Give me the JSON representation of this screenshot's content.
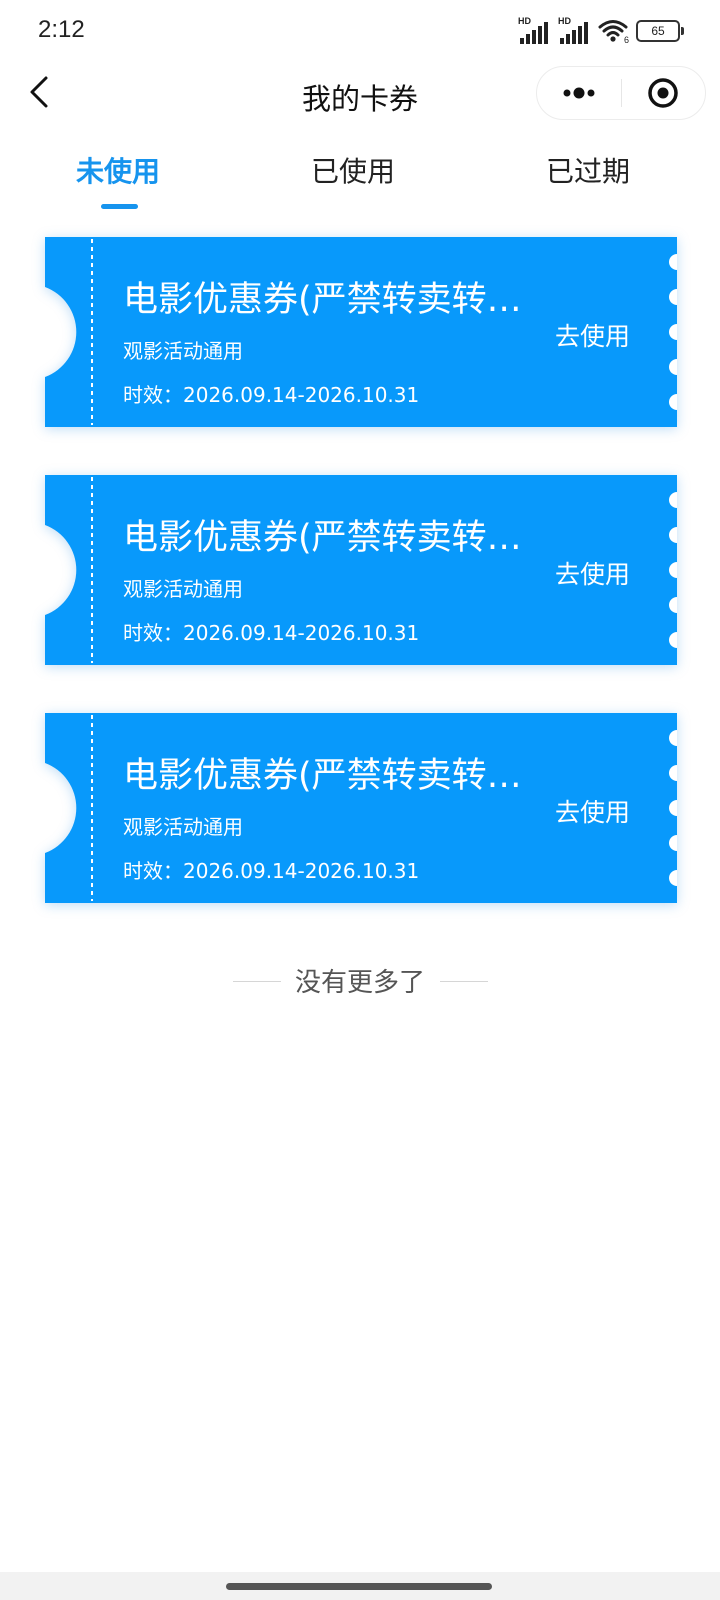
{
  "status_bar": {
    "time": "2:12",
    "signal_1_label": "HD",
    "signal_2_label": "HD",
    "wifi_label": "6",
    "battery": "65"
  },
  "nav": {
    "title": "我的卡券"
  },
  "tabs": [
    {
      "label": "未使用",
      "active": true
    },
    {
      "label": "已使用",
      "active": false
    },
    {
      "label": "已过期",
      "active": false
    }
  ],
  "coupons": [
    {
      "title": "电影优惠券(严禁转卖转…",
      "desc": "观影活动通用",
      "validity": "时效：2026.09.14-2026.10.31",
      "action": "去使用"
    },
    {
      "title": "电影优惠券(严禁转卖转…",
      "desc": "观影活动通用",
      "validity": "时效：2026.09.14-2026.10.31",
      "action": "去使用"
    },
    {
      "title": "电影优惠券(严禁转卖转…",
      "desc": "观影活动通用",
      "validity": "时效：2026.09.14-2026.10.31",
      "action": "去使用"
    }
  ],
  "footer": {
    "no_more": "没有更多了"
  },
  "colors": {
    "accent": "#1694ee",
    "coupon_bg": "#0899fb"
  }
}
